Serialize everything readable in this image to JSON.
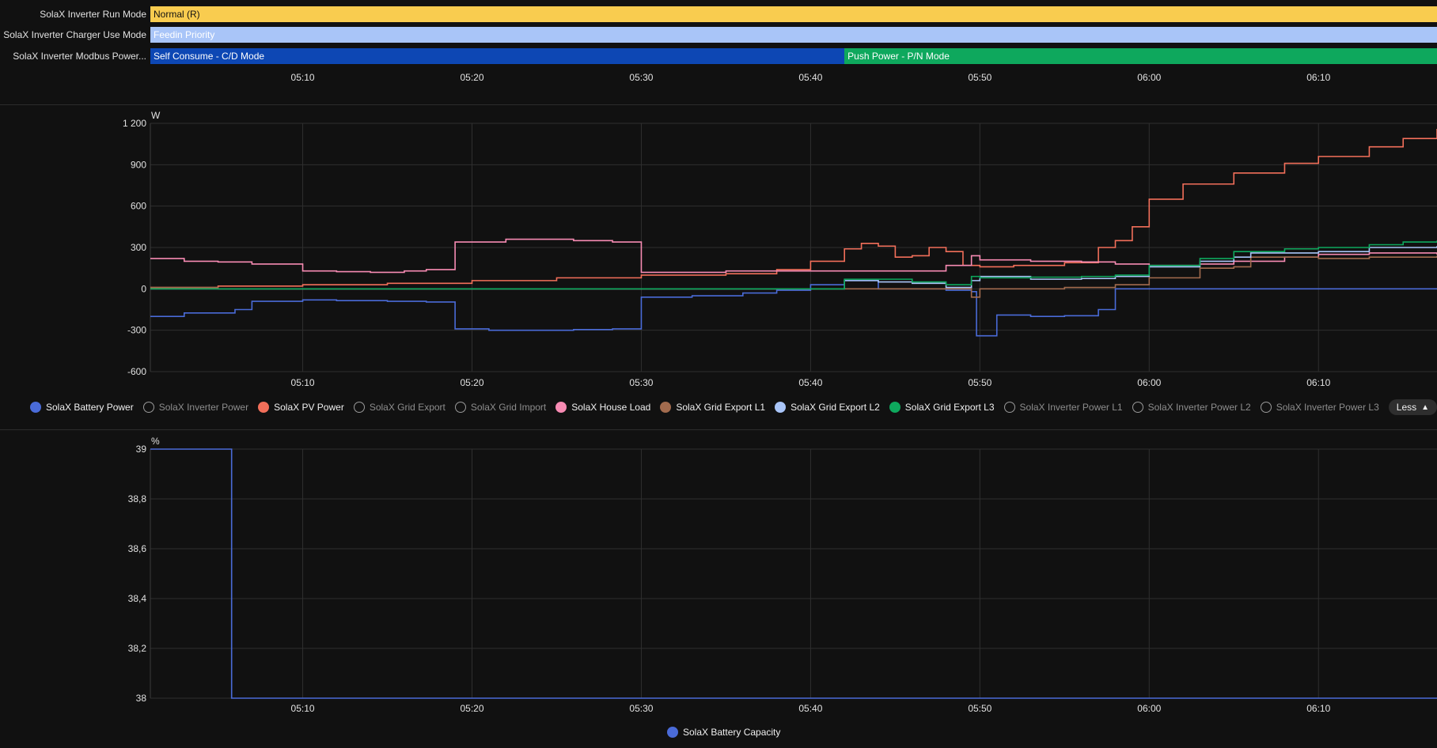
{
  "timeline": {
    "rows": [
      {
        "label": "SolaX Inverter Run Mode",
        "segments": [
          {
            "text": "Normal (R)",
            "start": "05:01",
            "end": "06:17",
            "color": "#f9cc4f",
            "text_color": "#111111"
          }
        ]
      },
      {
        "label": "SolaX Inverter Charger Use Mode",
        "segments": [
          {
            "text": "Feedin Priority",
            "start": "05:01",
            "end": "06:17",
            "color": "#a9c5f8",
            "text_color": "#ffffff"
          }
        ]
      },
      {
        "label": "SolaX Inverter Modbus Power...",
        "segments": [
          {
            "text": "Self Consume - C/D Mode",
            "start": "05:01",
            "end": "05:42",
            "color": "#0d47b4",
            "text_color": "#ffffff"
          },
          {
            "text": "Push Power - P/N Mode",
            "start": "05:42",
            "end": "06:17",
            "color": "#0ea85d",
            "text_color": "#ffffff"
          }
        ]
      }
    ],
    "ticks": [
      "05:10",
      "05:20",
      "05:30",
      "05:40",
      "05:50",
      "06:00",
      "06:10"
    ]
  },
  "chart_data": [
    {
      "type": "line",
      "ylabel": "W",
      "ylim": [
        -600,
        1200
      ],
      "yticks": [
        -600,
        -300,
        0,
        300,
        600,
        900,
        1200
      ],
      "ytick_labels": [
        "-600",
        "-300",
        "0",
        "300",
        "600",
        "900",
        "1 200"
      ],
      "xlim": [
        "05:01",
        "06:17"
      ],
      "xticks": [
        "05:10",
        "05:20",
        "05:30",
        "05:40",
        "05:50",
        "06:00",
        "06:10"
      ],
      "grid": true,
      "series": [
        {
          "name": "SolaX Battery Power",
          "color": "#4a6bd8",
          "step": true,
          "x": [
            "05:01",
            "05:03",
            "05:06",
            "05:07",
            "05:10",
            "05:12",
            "05:15",
            "05:17.3",
            "05:19",
            "05:21",
            "05:24",
            "05:26",
            "05:28.3",
            "05:30",
            "05:33",
            "05:36",
            "05:38",
            "05:40",
            "05:42",
            "05:44",
            "05:46",
            "05:48",
            "05:49.5",
            "05:49.8",
            "05:51",
            "05:53",
            "05:55",
            "05:57",
            "05:58",
            "06:00",
            "06:05",
            "06:10",
            "06:17"
          ],
          "y": [
            -200,
            -175,
            -150,
            -90,
            -80,
            -85,
            -90,
            -95,
            -290,
            -300,
            -300,
            -295,
            -290,
            -60,
            -50,
            -30,
            -10,
            30,
            60,
            0,
            0,
            -10,
            -20,
            -340,
            -190,
            -200,
            -195,
            -150,
            0,
            0,
            0,
            0,
            0
          ]
        },
        {
          "name": "SolaX PV Power",
          "color": "#f26f5a",
          "step": true,
          "x": [
            "05:01",
            "05:05",
            "05:10",
            "05:15",
            "05:20",
            "05:25",
            "05:30",
            "05:35",
            "05:38",
            "05:40",
            "05:42",
            "05:43",
            "05:44",
            "05:45",
            "05:46",
            "05:47",
            "05:48",
            "05:49",
            "05:50",
            "05:52",
            "05:55",
            "05:57",
            "05:58",
            "05:59",
            "06:00",
            "06:02",
            "06:05",
            "06:08",
            "06:10",
            "06:13",
            "06:15",
            "06:17"
          ],
          "y": [
            10,
            20,
            30,
            40,
            60,
            80,
            100,
            110,
            140,
            200,
            290,
            330,
            310,
            230,
            240,
            300,
            270,
            170,
            160,
            170,
            190,
            300,
            350,
            450,
            650,
            760,
            840,
            910,
            960,
            1030,
            1090,
            1160
          ]
        },
        {
          "name": "SolaX House Load",
          "color": "#f78bb3",
          "step": true,
          "x": [
            "05:01",
            "05:03",
            "05:05",
            "05:07",
            "05:10",
            "05:12",
            "05:14",
            "05:16",
            "05:17.3",
            "05:19",
            "05:22",
            "05:26",
            "05:28.3",
            "05:30",
            "05:35",
            "05:40",
            "05:45",
            "05:48",
            "05:49.5",
            "05:50",
            "05:53",
            "05:56",
            "05:58",
            "06:00",
            "06:03",
            "06:05",
            "06:08",
            "06:10",
            "06:13",
            "06:15",
            "06:17"
          ],
          "y": [
            220,
            200,
            195,
            180,
            130,
            125,
            120,
            130,
            140,
            340,
            360,
            350,
            340,
            120,
            130,
            130,
            130,
            170,
            240,
            210,
            200,
            195,
            180,
            170,
            180,
            200,
            230,
            250,
            260,
            260,
            250
          ]
        },
        {
          "name": "SolaX Grid Export L1",
          "color": "#a26b4e",
          "step": true,
          "x": [
            "05:01",
            "05:05",
            "05:10",
            "05:20",
            "05:30",
            "05:40",
            "05:42",
            "05:45",
            "05:48",
            "05:49.5",
            "05:50",
            "05:55",
            "05:58",
            "06:00",
            "06:03",
            "06:05",
            "06:06",
            "06:10",
            "06:13",
            "06:17"
          ],
          "y": [
            10,
            0,
            0,
            0,
            0,
            0,
            0,
            0,
            0,
            -60,
            0,
            10,
            30,
            80,
            150,
            160,
            230,
            220,
            230,
            240
          ]
        },
        {
          "name": "SolaX Grid Export L2",
          "color": "#a9c5f8",
          "step": true,
          "x": [
            "05:01",
            "05:10",
            "05:20",
            "05:30",
            "05:40",
            "05:42",
            "05:44",
            "05:46",
            "05:48",
            "05:49.5",
            "05:50",
            "05:53",
            "05:56",
            "05:58",
            "06:00",
            "06:03",
            "06:05",
            "06:06",
            "06:10",
            "06:13",
            "06:17"
          ],
          "y": [
            0,
            0,
            0,
            0,
            0,
            60,
            50,
            40,
            10,
            60,
            90,
            70,
            75,
            90,
            160,
            200,
            230,
            260,
            270,
            300,
            310
          ]
        },
        {
          "name": "SolaX Grid Export L3",
          "color": "#0ea85d",
          "step": true,
          "x": [
            "05:01",
            "05:10",
            "05:20",
            "05:30",
            "05:40",
            "05:42",
            "05:44",
            "05:46",
            "05:48",
            "05:49.5",
            "05:50",
            "05:53",
            "05:56",
            "05:58",
            "06:00",
            "06:03",
            "06:05",
            "06:08",
            "06:10",
            "06:13",
            "06:15",
            "06:17"
          ],
          "y": [
            0,
            0,
            0,
            0,
            0,
            70,
            70,
            50,
            30,
            90,
            80,
            85,
            90,
            100,
            170,
            220,
            270,
            290,
            300,
            320,
            340,
            350
          ]
        }
      ],
      "legend": [
        {
          "name": "SolaX Battery Power",
          "on": true,
          "color": "#4a6bd8"
        },
        {
          "name": "SolaX Inverter Power",
          "on": false
        },
        {
          "name": "SolaX PV Power",
          "on": true,
          "color": "#f26f5a"
        },
        {
          "name": "SolaX Grid Export",
          "on": false
        },
        {
          "name": "SolaX Grid Import",
          "on": false
        },
        {
          "name": "SolaX House Load",
          "on": true,
          "color": "#f78bb3"
        },
        {
          "name": "SolaX Grid Export L1",
          "on": true,
          "color": "#a26b4e"
        },
        {
          "name": "SolaX Grid Export L2",
          "on": true,
          "color": "#a9c5f8"
        },
        {
          "name": "SolaX Grid Export L3",
          "on": true,
          "color": "#0ea85d"
        },
        {
          "name": "SolaX Inverter Power L1",
          "on": false
        },
        {
          "name": "SolaX Inverter Power L2",
          "on": false
        },
        {
          "name": "SolaX Inverter Power L3",
          "on": false
        }
      ],
      "legend_toggle": "Less"
    },
    {
      "type": "line",
      "ylabel": "%",
      "ylim": [
        38,
        39
      ],
      "yticks": [
        38,
        38.2,
        38.4,
        38.6,
        38.8,
        39
      ],
      "ytick_labels": [
        "38",
        "38,2",
        "38,4",
        "38,6",
        "38,8",
        "39"
      ],
      "xlim": [
        "05:01",
        "06:17"
      ],
      "xticks": [
        "05:10",
        "05:20",
        "05:30",
        "05:40",
        "05:50",
        "06:00",
        "06:10"
      ],
      "grid": true,
      "series": [
        {
          "name": "SolaX Battery Capacity",
          "color": "#4a6bd8",
          "step": true,
          "x": [
            "05:01",
            "05:05.8",
            "06:17"
          ],
          "y": [
            39,
            38,
            38
          ]
        }
      ],
      "legend": [
        {
          "name": "SolaX Battery Capacity",
          "on": true,
          "color": "#4a6bd8"
        }
      ]
    }
  ]
}
